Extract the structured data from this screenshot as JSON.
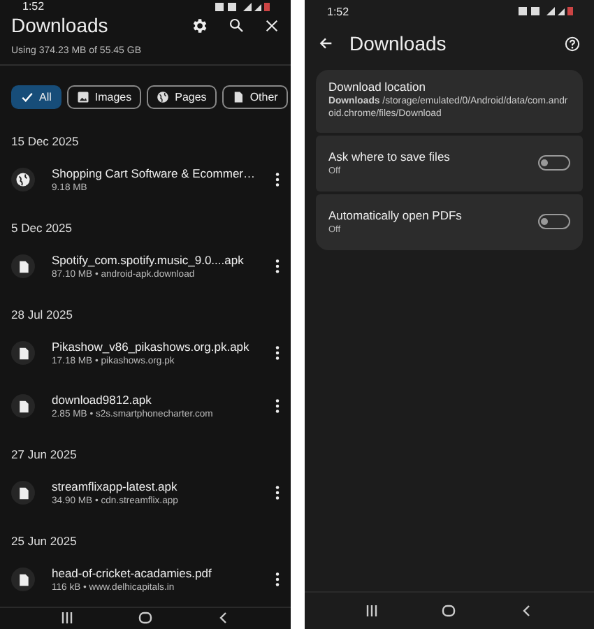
{
  "downloads_screen": {
    "status_bar": {
      "time": "1:52"
    },
    "title": "Downloads",
    "storage": "Using 374.23 MB of 55.45 GB",
    "filters": [
      {
        "label": "All",
        "kind": "check",
        "selected": true
      },
      {
        "label": "Images",
        "kind": "image",
        "selected": false
      },
      {
        "label": "Pages",
        "kind": "globe",
        "selected": false
      },
      {
        "label": "Other",
        "kind": "file",
        "selected": false
      }
    ],
    "groups": [
      {
        "date": "15 Dec 2025",
        "items": [
          {
            "kind": "globe",
            "name": "Shopping Cart Software & Ecommer…",
            "meta": "9.18 MB"
          }
        ]
      },
      {
        "date": "5 Dec 2025",
        "items": [
          {
            "kind": "file",
            "name": "Spotify_com.spotify.music_9.0....apk",
            "meta": "87.10 MB • android-apk.download"
          }
        ]
      },
      {
        "date": "28 Jul 2025",
        "items": [
          {
            "kind": "file",
            "name": "Pikashow_v86_pikashows.org.pk.apk",
            "meta": "17.18 MB • pikashows.org.pk"
          },
          {
            "kind": "file",
            "name": "download9812.apk",
            "meta": "2.85 MB • s2s.smartphonecharter.com"
          }
        ]
      },
      {
        "date": "27 Jun 2025",
        "items": [
          {
            "kind": "file",
            "name": "streamflixapp-latest.apk",
            "meta": "34.90 MB • cdn.streamflix.app"
          }
        ]
      },
      {
        "date": "25 Jun 2025",
        "items": [
          {
            "kind": "file",
            "name": "head-of-cricket-acadamies.pdf",
            "meta": "116 kB • www.delhicapitals.in"
          }
        ]
      }
    ]
  },
  "settings_screen": {
    "status_bar": {
      "time": "1:52"
    },
    "title": "Downloads",
    "location": {
      "title": "Download location",
      "detail": "**Downloads** /storage/emulated/0/Android/data/com.android.chrome/files/Download"
    },
    "toggles": [
      {
        "label": "Ask where to save files",
        "state": "Off",
        "on": false
      },
      {
        "label": "Automatically open PDFs",
        "state": "Off",
        "on": false
      }
    ]
  }
}
